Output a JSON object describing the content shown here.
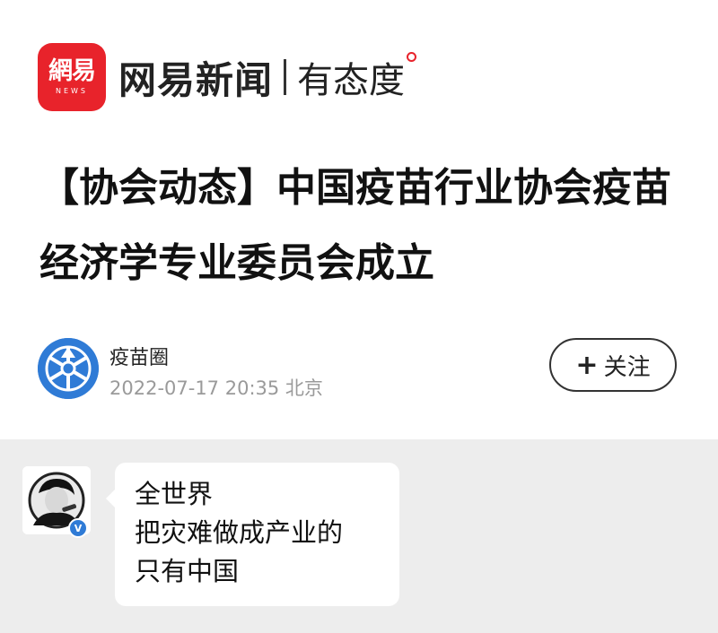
{
  "brand": {
    "logo_cn": "網易",
    "logo_en": "NEWS",
    "name": "网易新闻",
    "slogan": "有态度",
    "accent": "#e8232b"
  },
  "article": {
    "title": "【协会动态】中国疫苗行业协会疫苗经济学专业委员会成立"
  },
  "source": {
    "name": "疫苗圈",
    "meta": "2022-07-17 20:35 北京",
    "avatar_color": "#2f7bd6",
    "follow_plus": "+",
    "follow_label": "关注"
  },
  "chat": {
    "badge": "V",
    "lines": [
      "全世界",
      "把灾难做成产业的",
      "只有中国"
    ]
  }
}
